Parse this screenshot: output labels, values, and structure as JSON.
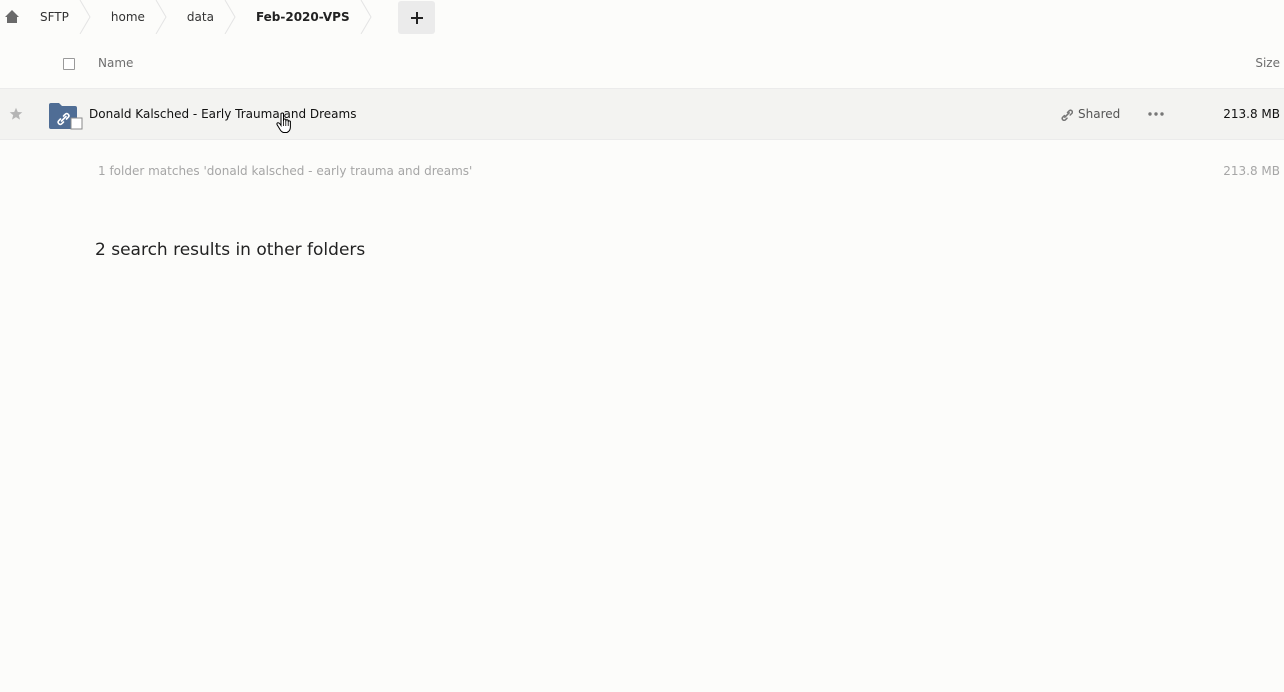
{
  "breadcrumb": {
    "items": [
      {
        "label": "SFTP"
      },
      {
        "label": "home"
      },
      {
        "label": "data"
      },
      {
        "label": "Feb-2020-VPS"
      }
    ],
    "add_label": "+"
  },
  "header": {
    "name_label": "Name",
    "size_label": "Size"
  },
  "files": [
    {
      "name": "Donald Kalsched - Early Trauma and Dreams",
      "shared_label": "Shared",
      "size": "213.8 MB"
    }
  ],
  "summary": {
    "text": "1 folder matches 'donald kalsched - early trauma and dreams'",
    "size": "213.8 MB"
  },
  "other_results": "2 search results in other folders",
  "colors": {
    "folder": "#4f6d95",
    "background": "#fcfcfa",
    "row_hover": "#f3f3f1"
  }
}
